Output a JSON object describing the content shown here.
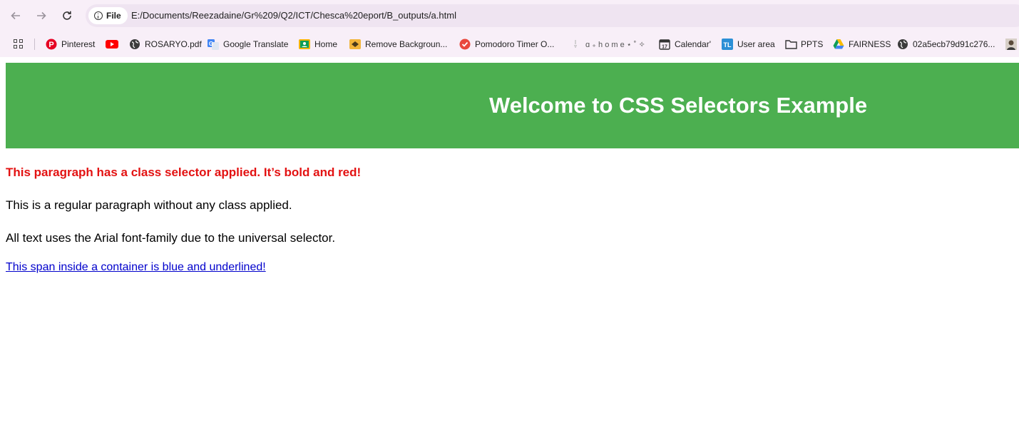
{
  "browser": {
    "chip_label": "File",
    "url": "E:/Documents/Reezadaine/Gr%209/Q2/ICT/Chesca%20eport/B_outputs/a.html",
    "bookmarks": [
      {
        "label": "Pinterest",
        "icon": "pinterest-icon"
      },
      {
        "label": "",
        "icon": "youtube-icon"
      },
      {
        "label": "ROSARYO.pdf",
        "icon": "globe-icon"
      },
      {
        "label": "Google Translate",
        "icon": "translate-icon"
      },
      {
        "label": "Home",
        "icon": "classroom-icon"
      },
      {
        "label": "Remove Backgroun...",
        "icon": "remove-bg-icon"
      },
      {
        "label": "Pomodoro Timer O...",
        "icon": "pomodoro-icon"
      },
      {
        "label": "ɑ ₊ h o m e ⋆ ˚ ✧",
        "icon": "sparkle-icon"
      },
      {
        "label": "Calendar'",
        "icon": "calendar-icon"
      },
      {
        "label": "User area",
        "icon": "tl-icon"
      },
      {
        "label": "PPTS",
        "icon": "folder-icon"
      },
      {
        "label": "FAIRNESS",
        "icon": "drive-icon"
      },
      {
        "label": "02a5ecb79d91c276...",
        "icon": "globe-icon"
      },
      {
        "label": "",
        "icon": "avatar-icon"
      }
    ],
    "colors": {
      "chrome_bg": "#f8eff8",
      "omnibox_bg": "#efe4f1"
    }
  },
  "page": {
    "header_title": "Welcome to CSS Selectors Example",
    "red_paragraph": "This paragraph has a class selector applied. It’s bold and red!",
    "regular_paragraph": "This is a regular paragraph without any class applied.",
    "arial_paragraph": "All text uses the Arial font-family due to the universal selector.",
    "blue_span": "This span inside a container is blue and underlined!",
    "colors": {
      "header_bg": "#4caf50",
      "header_text": "#ffffff",
      "red_text": "#e31212",
      "blue_text": "#0000cc"
    }
  }
}
